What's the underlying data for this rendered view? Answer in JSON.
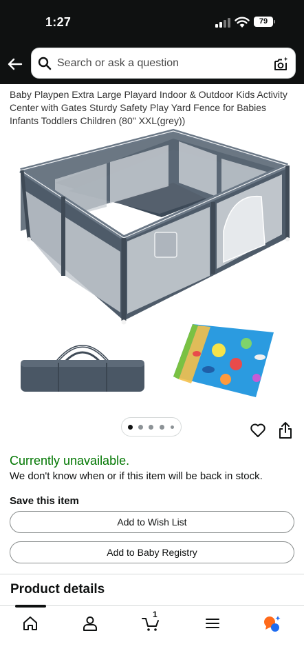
{
  "status_bar": {
    "time": "1:27",
    "battery": "79"
  },
  "search": {
    "placeholder": "Search or ask a question"
  },
  "product": {
    "title": "Baby Playpen Extra Large Playard Indoor & Outdoor Kids Activity Center with Gates Sturdy Safety Play Yard Fence for Babies Infants Toddlers Children (80\" XXL(grey))",
    "carousel": {
      "count": 5,
      "active": 1
    }
  },
  "availability": {
    "status": "Currently unavailable.",
    "note": "We don't know when or if this item will be back in stock."
  },
  "save": {
    "heading": "Save this item",
    "wish_list": "Add to Wish List",
    "baby_registry": "Add to Baby Registry"
  },
  "details": {
    "heading": "Product details"
  },
  "bottom_nav": {
    "cart_count": "1",
    "items": [
      "home-icon",
      "account-icon",
      "cart-icon",
      "menu-icon",
      "rufus-icon"
    ]
  },
  "colors": {
    "header": "#0f1111",
    "available": "#007600",
    "playpen": "#4d5b6b",
    "rufus_orange": "#ff6a1a",
    "rufus_blue": "#1e6cf0"
  }
}
